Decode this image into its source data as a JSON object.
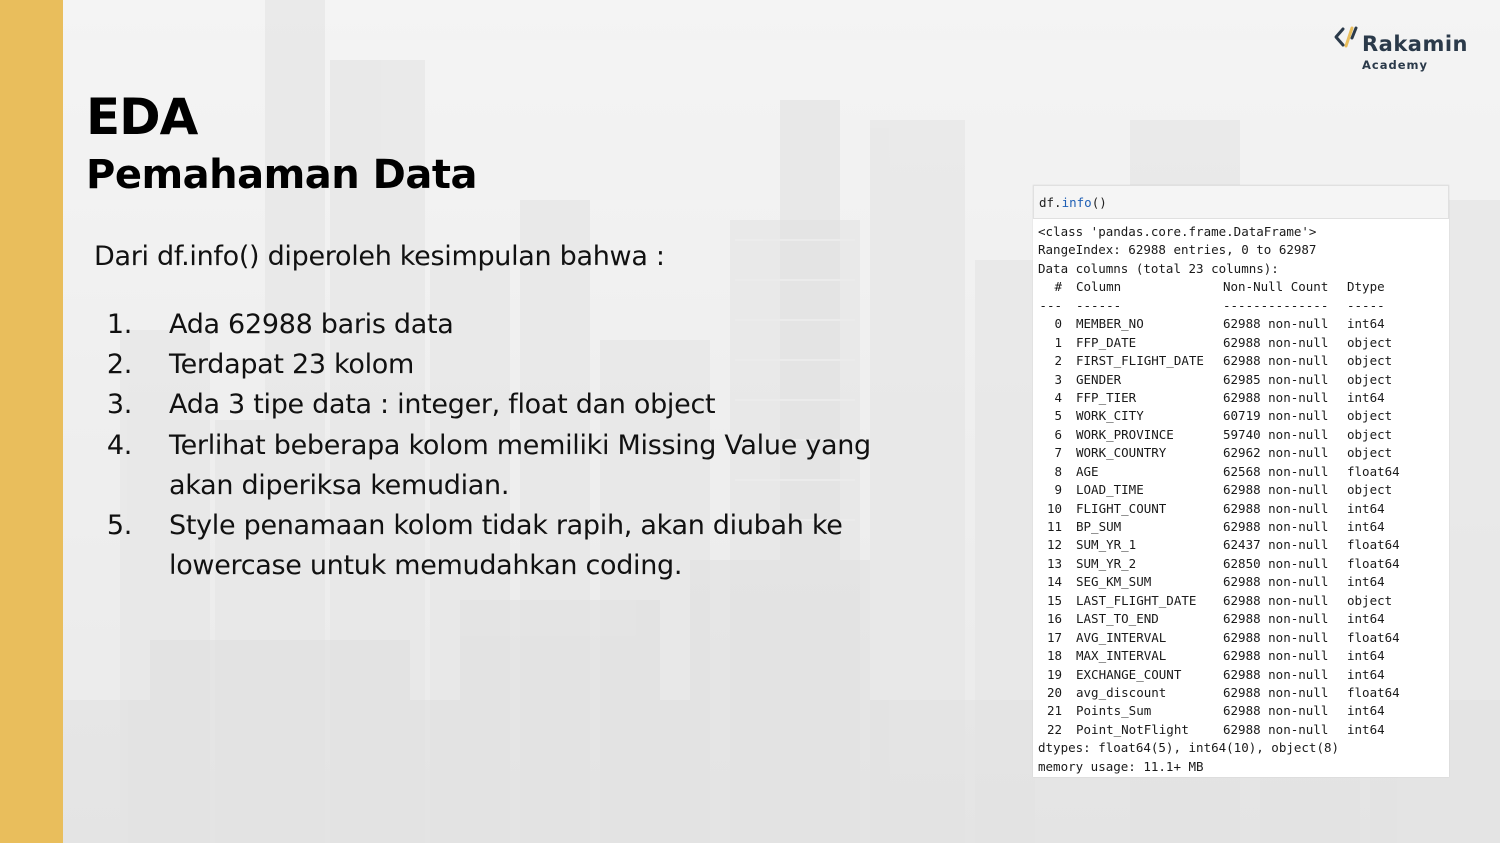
{
  "slide": {
    "title": "EDA",
    "subtitle": "Pemahaman Data",
    "intro": "Dari df.info() diperoleh kesimpulan bahwa :",
    "points": [
      {
        "num": "1.",
        "lines": [
          "Ada 62988 baris data"
        ]
      },
      {
        "num": "2.",
        "lines": [
          "Terdapat 23 kolom"
        ]
      },
      {
        "num": "3.",
        "lines": [
          "Ada 3 tipe data : integer, float dan object"
        ]
      },
      {
        "num": "4.",
        "lines": [
          "Terlihat beberapa kolom memiliki Missing Value yang",
          "akan diperiksa kemudian."
        ]
      },
      {
        "num": "5.",
        "lines": [
          "Style penamaan kolom tidak rapih, akan diubah ke",
          "lowercase untuk memudahkan coding."
        ]
      }
    ]
  },
  "logo": {
    "name": "Rakamin",
    "sub": "Academy",
    "colors": {
      "text": "#2b3a4a",
      "chevron": "#2b3a4a",
      "slash": "#E9BE5C"
    }
  },
  "colors": {
    "accent": "#E9BE5C",
    "background": "#ededed",
    "code_bg": "#ffffff",
    "code_input_bg": "#f5f5f5",
    "code_fn": "#1f5fb5"
  },
  "code": {
    "input_obj": "df.",
    "input_fn": "info",
    "input_suffix": "()",
    "output_head": [
      "<class 'pandas.core.frame.DataFrame'>",
      "RangeIndex: 62988 entries, 0 to 62987",
      "Data columns (total 23 columns):"
    ],
    "table_header": {
      "idx": "#",
      "name": "Column",
      "count": "Non-Null Count",
      "type": "Dtype"
    },
    "table_rule": {
      "idx": "---",
      "name": "------",
      "count": "--------------",
      "type": "-----"
    },
    "columns": [
      {
        "idx": "0",
        "name": "MEMBER_NO",
        "count": "62988 non-null",
        "type": "int64"
      },
      {
        "idx": "1",
        "name": "FFP_DATE",
        "count": "62988 non-null",
        "type": "object"
      },
      {
        "idx": "2",
        "name": "FIRST_FLIGHT_DATE",
        "count": "62988 non-null",
        "type": "object"
      },
      {
        "idx": "3",
        "name": "GENDER",
        "count": "62985 non-null",
        "type": "object"
      },
      {
        "idx": "4",
        "name": "FFP_TIER",
        "count": "62988 non-null",
        "type": "int64"
      },
      {
        "idx": "5",
        "name": "WORK_CITY",
        "count": "60719 non-null",
        "type": "object"
      },
      {
        "idx": "6",
        "name": "WORK_PROVINCE",
        "count": "59740 non-null",
        "type": "object"
      },
      {
        "idx": "7",
        "name": "WORK_COUNTRY",
        "count": "62962 non-null",
        "type": "object"
      },
      {
        "idx": "8",
        "name": "AGE",
        "count": "62568 non-null",
        "type": "float64"
      },
      {
        "idx": "9",
        "name": "LOAD_TIME",
        "count": "62988 non-null",
        "type": "object"
      },
      {
        "idx": "10",
        "name": "FLIGHT_COUNT",
        "count": "62988 non-null",
        "type": "int64"
      },
      {
        "idx": "11",
        "name": "BP_SUM",
        "count": "62988 non-null",
        "type": "int64"
      },
      {
        "idx": "12",
        "name": "SUM_YR_1",
        "count": "62437 non-null",
        "type": "float64"
      },
      {
        "idx": "13",
        "name": "SUM_YR_2",
        "count": "62850 non-null",
        "type": "float64"
      },
      {
        "idx": "14",
        "name": "SEG_KM_SUM",
        "count": "62988 non-null",
        "type": "int64"
      },
      {
        "idx": "15",
        "name": "LAST_FLIGHT_DATE",
        "count": "62988 non-null",
        "type": "object"
      },
      {
        "idx": "16",
        "name": "LAST_TO_END",
        "count": "62988 non-null",
        "type": "int64"
      },
      {
        "idx": "17",
        "name": "AVG_INTERVAL",
        "count": "62988 non-null",
        "type": "float64"
      },
      {
        "idx": "18",
        "name": "MAX_INTERVAL",
        "count": "62988 non-null",
        "type": "int64"
      },
      {
        "idx": "19",
        "name": "EXCHANGE_COUNT",
        "count": "62988 non-null",
        "type": "int64"
      },
      {
        "idx": "20",
        "name": "avg_discount",
        "count": "62988 non-null",
        "type": "float64"
      },
      {
        "idx": "21",
        "name": "Points_Sum",
        "count": "62988 non-null",
        "type": "int64"
      },
      {
        "idx": "22",
        "name": "Point_NotFlight",
        "count": "62988 non-null",
        "type": "int64"
      }
    ],
    "output_tail": [
      "dtypes: float64(5), int64(10), object(8)",
      "memory usage: 11.1+ MB"
    ]
  }
}
